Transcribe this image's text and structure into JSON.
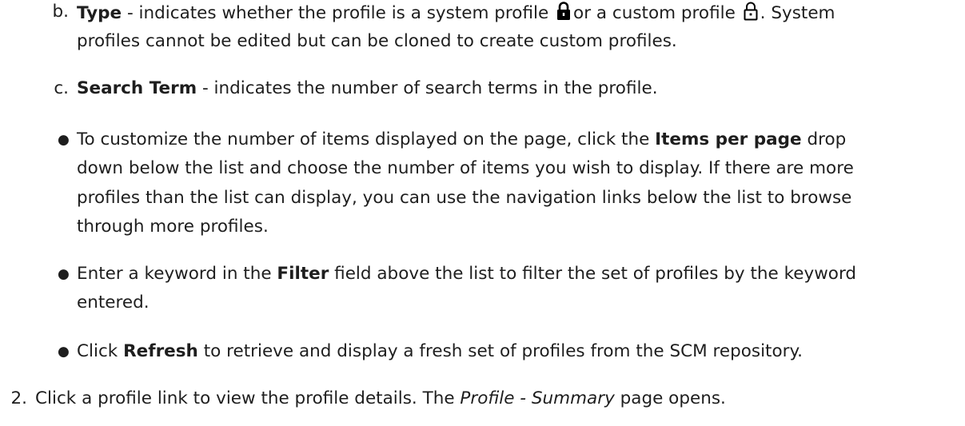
{
  "items": {
    "b": {
      "marker": "b.",
      "term": "Type",
      "part1": " - indicates whether the profile is a system profile",
      "part2": "or a custom profile",
      "part3": ".  System",
      "line2": "profiles cannot be edited but can be cloned to create custom profiles.",
      "system_icon": "locked-lock-icon",
      "custom_icon": "unlocked-lock-icon"
    },
    "c": {
      "marker": "c.",
      "term": "Search Term",
      "text": " - indicates the number of search terms in the profile."
    }
  },
  "bullets": [
    {
      "line1_pre": "To customize the number of items displayed on the page, click the ",
      "line1_bold": "Items per page",
      "line1_post": " drop",
      "line2": "down below the list and choose the number of items you wish to display. If there are more",
      "line3": "profiles than the list can display, you can use the navigation links below the list to browse",
      "line4": "through more profiles."
    },
    {
      "line1_pre": "Enter a keyword in the ",
      "line1_bold": "Filter",
      "line1_post": " field above the list to filter the set of profiles by the keyword",
      "line2": "entered."
    },
    {
      "line1_pre": "Click ",
      "line1_bold": "Refresh",
      "line1_post": " to retrieve and display a fresh set of profiles from the SCM repository."
    }
  ],
  "step2": {
    "marker": "2.",
    "pre": "Click a profile link to view the profile details. The ",
    "italic": "Profile - Summary",
    "post": " page opens."
  }
}
